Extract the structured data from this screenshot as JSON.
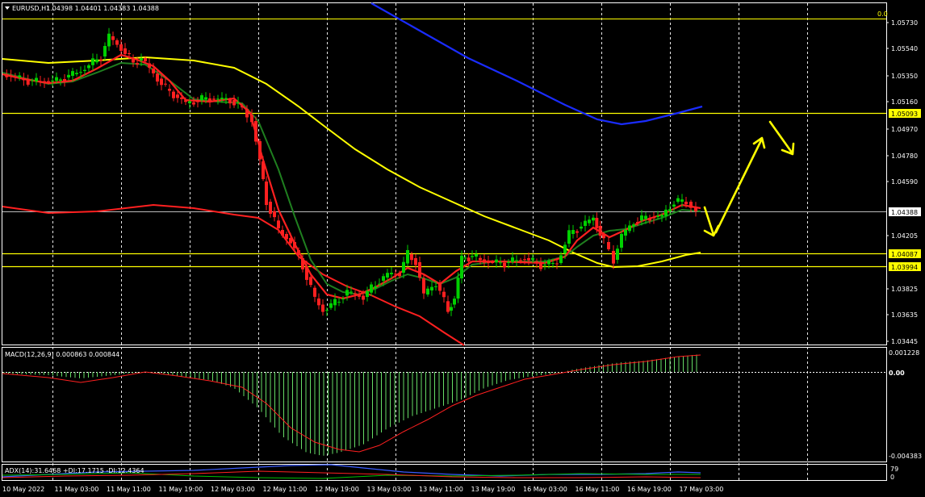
{
  "header": {
    "symbol": "EURUSD,H1",
    "ohlc": "1.04398 1.04401 1.04383 1.04388",
    "corner_value": "0.0"
  },
  "price_axis": {
    "ticks": [
      "1.05730",
      "1.05540",
      "1.05350",
      "1.05160",
      "1.04970",
      "1.04780",
      "1.04590",
      "1.04205",
      "1.03825",
      "1.03635",
      "1.03445"
    ],
    "levels": [
      {
        "label": "1.05093",
        "color": "#ffff00"
      },
      {
        "label": "1.04388",
        "color": "#ffffff"
      },
      {
        "label": "1.04087",
        "color": "#ffff00"
      },
      {
        "label": "1.03994",
        "color": "#ffff00"
      }
    ]
  },
  "macd": {
    "label": "MACD(12,26,9) 0.000863 0.000844",
    "ticks": [
      "0.001228",
      "0.00",
      "-0.004383"
    ]
  },
  "adx": {
    "label": "ADX(14):31.6468 +DI:17.1715 -DI:12.4364",
    "ticks": [
      "79",
      "0"
    ]
  },
  "time_axis": [
    "10 May 2022",
    "11 May 03:00",
    "11 May 11:00",
    "11 May 19:00",
    "12 May 03:00",
    "12 May 11:00",
    "12 May 19:00",
    "13 May 03:00",
    "13 May 11:00",
    "13 May 19:00",
    "16 May 03:00",
    "16 May 11:00",
    "16 May 19:00",
    "17 May 03:00"
  ],
  "colors": {
    "bull": "#00d000",
    "bear": "#ff2020",
    "ma_fast": "#ff2020",
    "ma_green": "#1f7f1f",
    "ma_yellow": "#ffff00",
    "ma_blue": "#1a2cff",
    "ma_red_slow": "#ff2020",
    "grid": "#ffffff",
    "arrow": "#ffff00"
  },
  "chart_data": {
    "type": "candlestick",
    "symbol": "EURUSD,H1",
    "ylim": [
      1.03445,
      1.0583
    ],
    "horizontal_levels": [
      1.05093,
      1.04388,
      1.04087,
      1.03994
    ],
    "key_points": [
      {
        "x": "10 May 2022",
        "price": 1.0535
      },
      {
        "x": "11 May 11:00",
        "price": 1.0565
      },
      {
        "x": "12 May 03:00",
        "price": 1.052
      },
      {
        "x": "12 May 11:00",
        "price": 1.041
      },
      {
        "x": "12 May 19:00",
        "price": 1.0362
      },
      {
        "x": "13 May 03:00",
        "price": 1.0378
      },
      {
        "x": "13 May 11:00",
        "price": 1.0405
      },
      {
        "x": "13 May 19:00",
        "price": 1.0398
      },
      {
        "x": "16 May 03:00",
        "price": 1.04
      },
      {
        "x": "16 May 11:00",
        "price": 1.0425
      },
      {
        "x": "16 May 19:00",
        "price": 1.0432
      },
      {
        "x": "17 May 03:00",
        "price": 1.04388
      }
    ]
  }
}
